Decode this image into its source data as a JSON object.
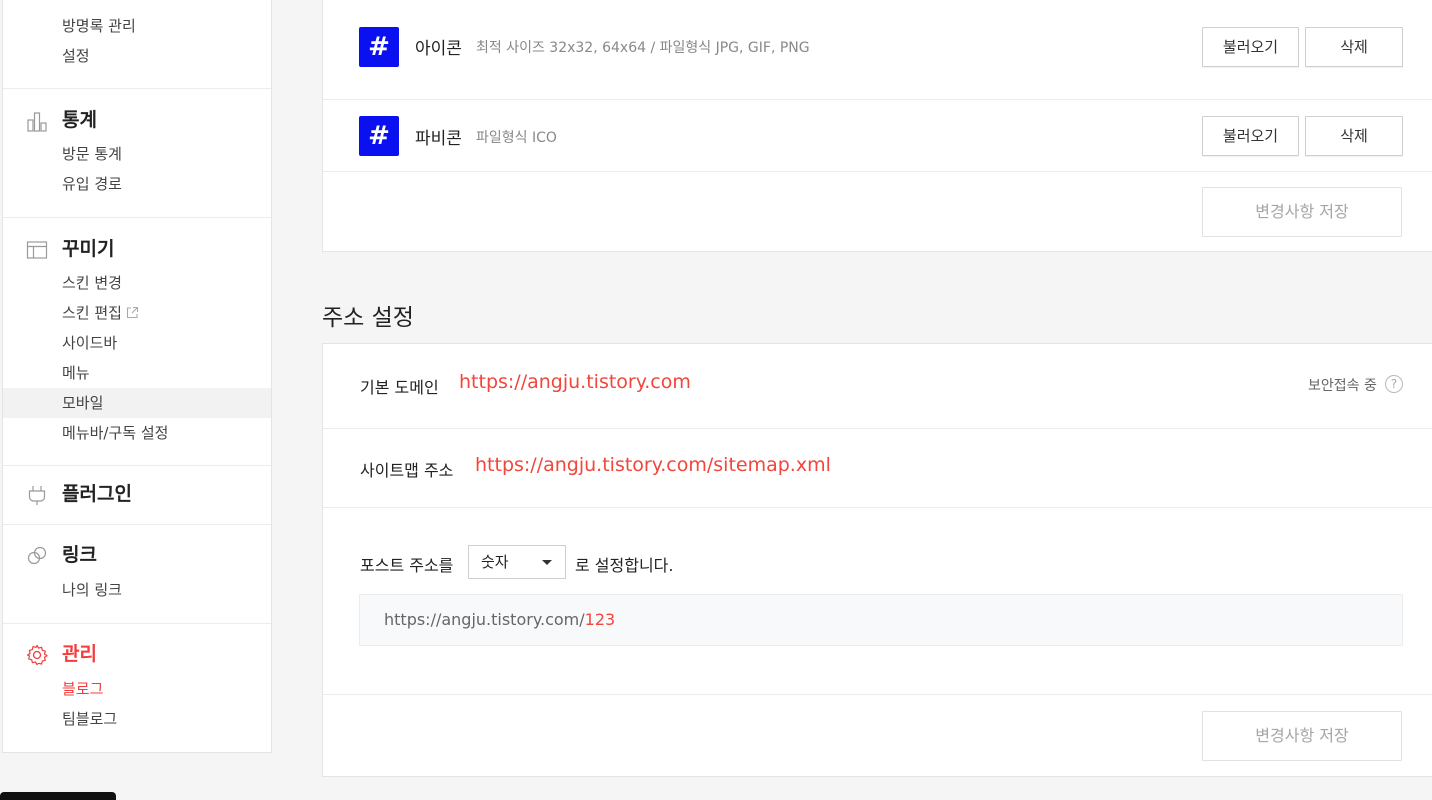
{
  "sidebar": {
    "top_items": [
      "방명록 관리",
      "설정"
    ],
    "stats": {
      "title": "통계",
      "items": [
        "방문 통계",
        "유입 경로"
      ]
    },
    "decorate": {
      "title": "꾸미기",
      "items": [
        "스킨 변경",
        "스킨 편집",
        "사이드바",
        "메뉴",
        "모바일",
        "메뉴바/구독 설정"
      ]
    },
    "plugin": {
      "title": "플러그인"
    },
    "link": {
      "title": "링크",
      "items": [
        "나의 링크"
      ]
    },
    "manage": {
      "title": "관리",
      "items": [
        "블로그",
        "팀블로그"
      ]
    }
  },
  "icons_panel": {
    "icon_row": {
      "badge": "#",
      "label": "아이콘",
      "desc": "최적 사이즈 32x32, 64x64 / 파일형식 JPG, GIF, PNG",
      "load_btn": "불러오기",
      "delete_btn": "삭제"
    },
    "favicon_row": {
      "badge": "#",
      "label": "파비콘",
      "desc": "파일형식 ICO",
      "load_btn": "불러오기",
      "delete_btn": "삭제"
    },
    "save_btn": "변경사항 저장"
  },
  "address": {
    "title": "주소 설정",
    "default_domain_label": "기본 도메인",
    "default_domain_url": "https://angju.tistory.com",
    "secure_label": "보안접속 중",
    "help_glyph": "?",
    "sitemap_label": "사이트맵 주소",
    "sitemap_url": "https://angju.tistory.com/sitemap.xml",
    "post_prefix": "포스트 주소를",
    "post_select_value": "숫자",
    "post_suffix": "로 설정합니다.",
    "preview_base": "https://angju.tistory.com/",
    "preview_tail": "123",
    "save_btn": "변경사항 저장"
  },
  "colors": {
    "accent_red": "#f2453b",
    "badge_blue": "#0b10f0"
  }
}
